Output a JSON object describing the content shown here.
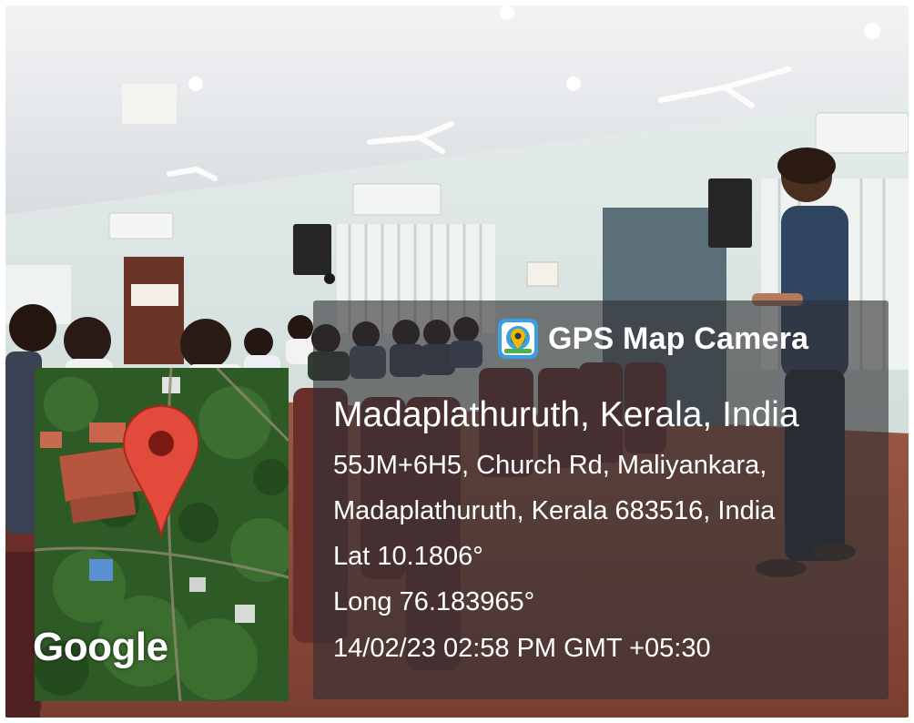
{
  "overlay": {
    "app_name": "GPS Map Camera",
    "location_title": "Madaplathuruth, Kerala, India",
    "address_line_1": "55JM+6H5, Church Rd, Maliyankara,",
    "address_line_2": "Madaplathuruth, Kerala 683516, India",
    "latitude": "Lat 10.1806°",
    "longitude": "Long 76.183965°",
    "timestamp": "14/02/23 02:58 PM GMT +05:30",
    "map_watermark": "Google"
  },
  "colors": {
    "panel_bg": "#303034",
    "pin_red": "#e24a3b",
    "text": "#ffffff",
    "ceiling": "#e9ecef",
    "wall": "#dfe9e7",
    "floor": "#8a4a38",
    "chair": "#6a2e2b"
  },
  "icons": [
    "camera-app-icon",
    "map-pin-icon"
  ]
}
